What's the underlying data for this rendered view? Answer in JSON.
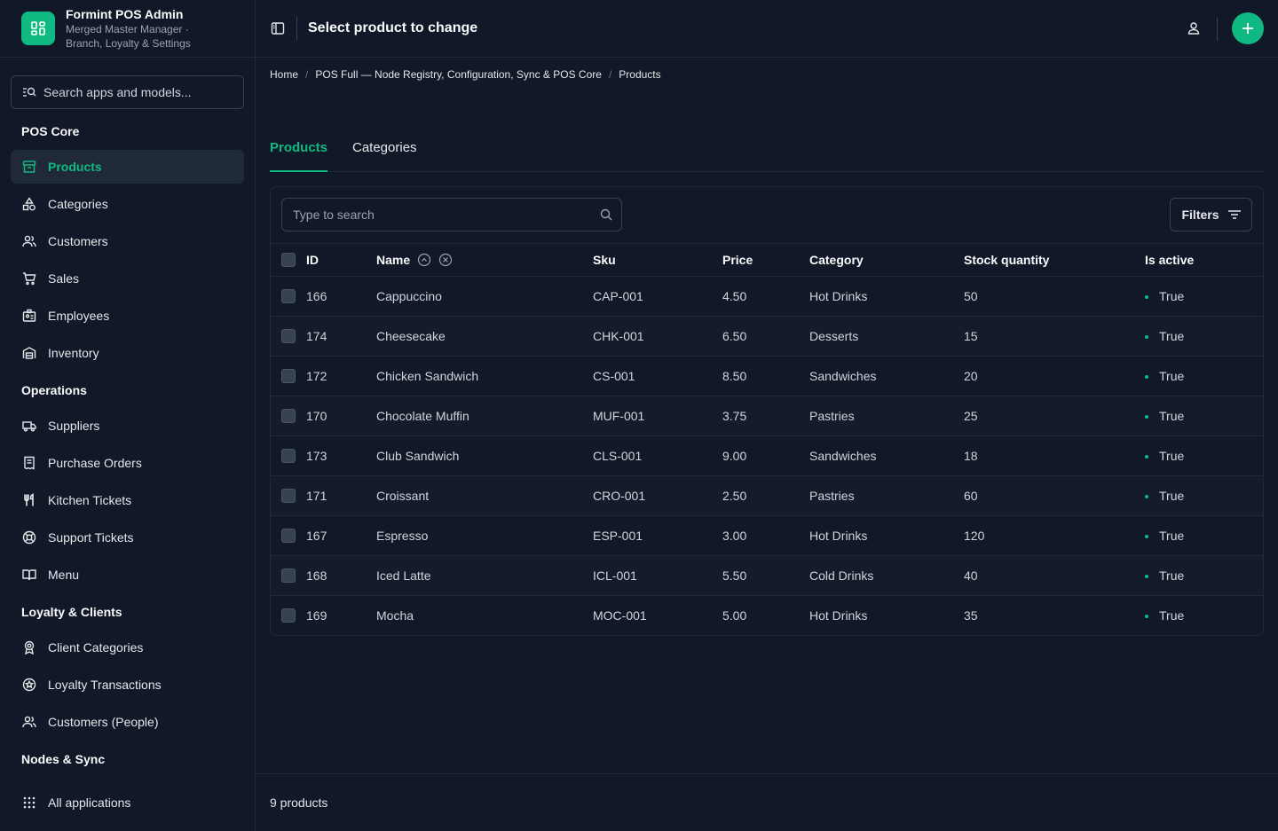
{
  "brand": {
    "title": "Formint POS Admin",
    "subtitle_line1": "Merged Master Manager ·",
    "subtitle_line2": "Branch, Loyalty & Settings"
  },
  "sidebar": {
    "search_label": "Search apps and models...",
    "sections": {
      "pos_core": "POS Core",
      "operations": "Operations",
      "loyalty": "Loyalty & Clients",
      "nodes": "Nodes & Sync"
    },
    "items": {
      "products": "Products",
      "categories": "Categories",
      "customers": "Customers",
      "sales": "Sales",
      "employees": "Employees",
      "inventory": "Inventory",
      "suppliers": "Suppliers",
      "purchase_orders": "Purchase Orders",
      "kitchen_tickets": "Kitchen Tickets",
      "support_tickets": "Support Tickets",
      "menu": "Menu",
      "client_categories": "Client Categories",
      "loyalty_transactions": "Loyalty Transactions",
      "customers_people": "Customers (People)",
      "all_applications": "All applications"
    }
  },
  "header": {
    "title": "Select product to change"
  },
  "breadcrumb": {
    "home": "Home",
    "app": "POS Full — Node Registry, Configuration, Sync & POS Core",
    "current": "Products"
  },
  "tabs": {
    "products": "Products",
    "categories": "Categories"
  },
  "toolbar": {
    "search_placeholder": "Type to search",
    "filters_label": "Filters"
  },
  "table": {
    "columns": [
      "ID",
      "Name",
      "Sku",
      "Price",
      "Category",
      "Stock quantity",
      "Is active"
    ],
    "rows": [
      [
        "166",
        "Cappuccino",
        "CAP-001",
        "4.50",
        "Hot Drinks",
        "50",
        "True"
      ],
      [
        "174",
        "Cheesecake",
        "CHK-001",
        "6.50",
        "Desserts",
        "15",
        "True"
      ],
      [
        "172",
        "Chicken Sandwich",
        "CS-001",
        "8.50",
        "Sandwiches",
        "20",
        "True"
      ],
      [
        "170",
        "Chocolate Muffin",
        "MUF-001",
        "3.75",
        "Pastries",
        "25",
        "True"
      ],
      [
        "173",
        "Club Sandwich",
        "CLS-001",
        "9.00",
        "Sandwiches",
        "18",
        "True"
      ],
      [
        "171",
        "Croissant",
        "CRO-001",
        "2.50",
        "Pastries",
        "60",
        "True"
      ],
      [
        "167",
        "Espresso",
        "ESP-001",
        "3.00",
        "Hot Drinks",
        "120",
        "True"
      ],
      [
        "168",
        "Iced Latte",
        "ICL-001",
        "5.50",
        "Cold Drinks",
        "40",
        "True"
      ],
      [
        "169",
        "Mocha",
        "MOC-001",
        "5.00",
        "Hot Drinks",
        "35",
        "True"
      ]
    ]
  },
  "footer": {
    "count": "9 products"
  },
  "colors": {
    "accent": "#10b981",
    "background": "#111827",
    "border": "#1f2937"
  }
}
